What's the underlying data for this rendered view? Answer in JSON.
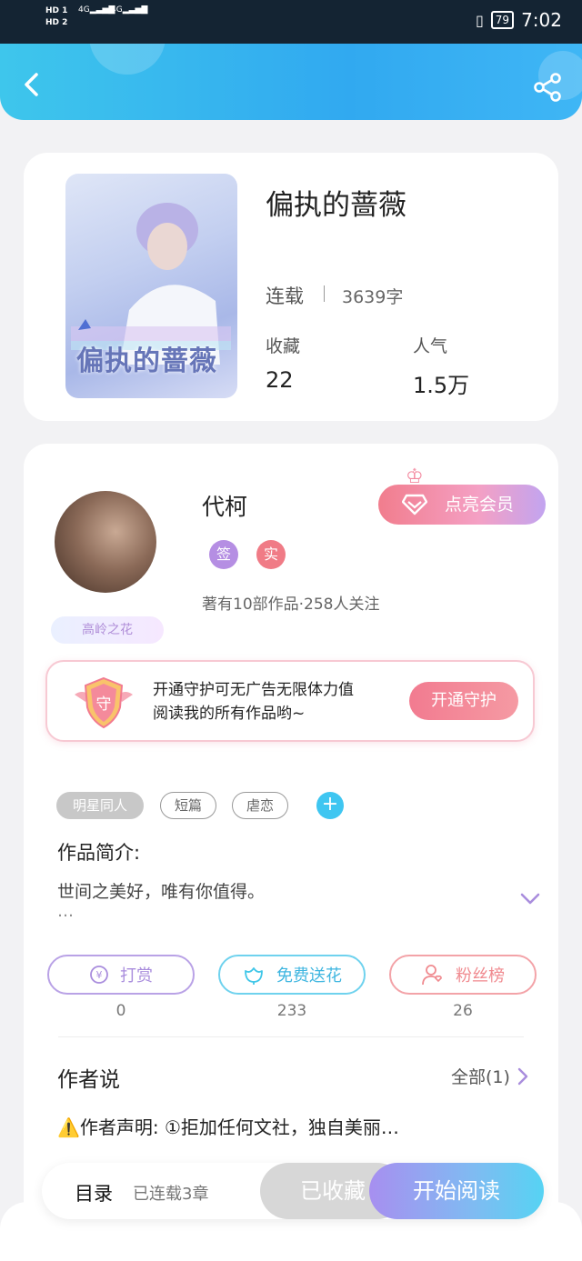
{
  "status_bar": {
    "hd1": "HD",
    "hd2": "HD",
    "sim1": "1",
    "sim2": "2",
    "net1": "4G",
    "net2": "4G",
    "battery": "79",
    "time": "7:02"
  },
  "book": {
    "title": "偏执的蔷薇",
    "cover_text": "偏执的蔷薇",
    "status": "连载",
    "word_count": "3639字",
    "favorites_label": "收藏",
    "favorites_value": "22",
    "popularity_label": "人气",
    "popularity_value": "1.5万"
  },
  "author": {
    "name": "代柯",
    "badge_sign": "签",
    "badge_real": "实",
    "meta": "著有10部作品·258人关注",
    "title_tag": "高岭之花",
    "vip_button": "点亮会员"
  },
  "guard": {
    "shield_char": "守",
    "line1": "开通守护可无广告无限体力值",
    "line2": "阅读我的所有作品哟~",
    "button": "开通守护"
  },
  "tags": [
    "明星同人",
    "短篇",
    "虐恋"
  ],
  "tag_add": "+",
  "intro": {
    "label": "作品简介:",
    "text": "世间之美好，唯有你值得。",
    "ellipsis": "…"
  },
  "actions": [
    {
      "label": "打赏",
      "count": "0",
      "color": "#a98ddd"
    },
    {
      "label": "免费送花",
      "count": "233",
      "color": "#3fc6e8"
    },
    {
      "label": "粉丝榜",
      "count": "26",
      "color": "#f08a8f"
    }
  ],
  "author_says": {
    "title": "作者说",
    "all": "全部(1)",
    "text": "⚠️作者声明: ①拒加任何文社，独自美丽…"
  },
  "bottom": {
    "toc": "目录",
    "chapters": "已连载3章",
    "collected": "已收藏",
    "read": "开始阅读"
  }
}
